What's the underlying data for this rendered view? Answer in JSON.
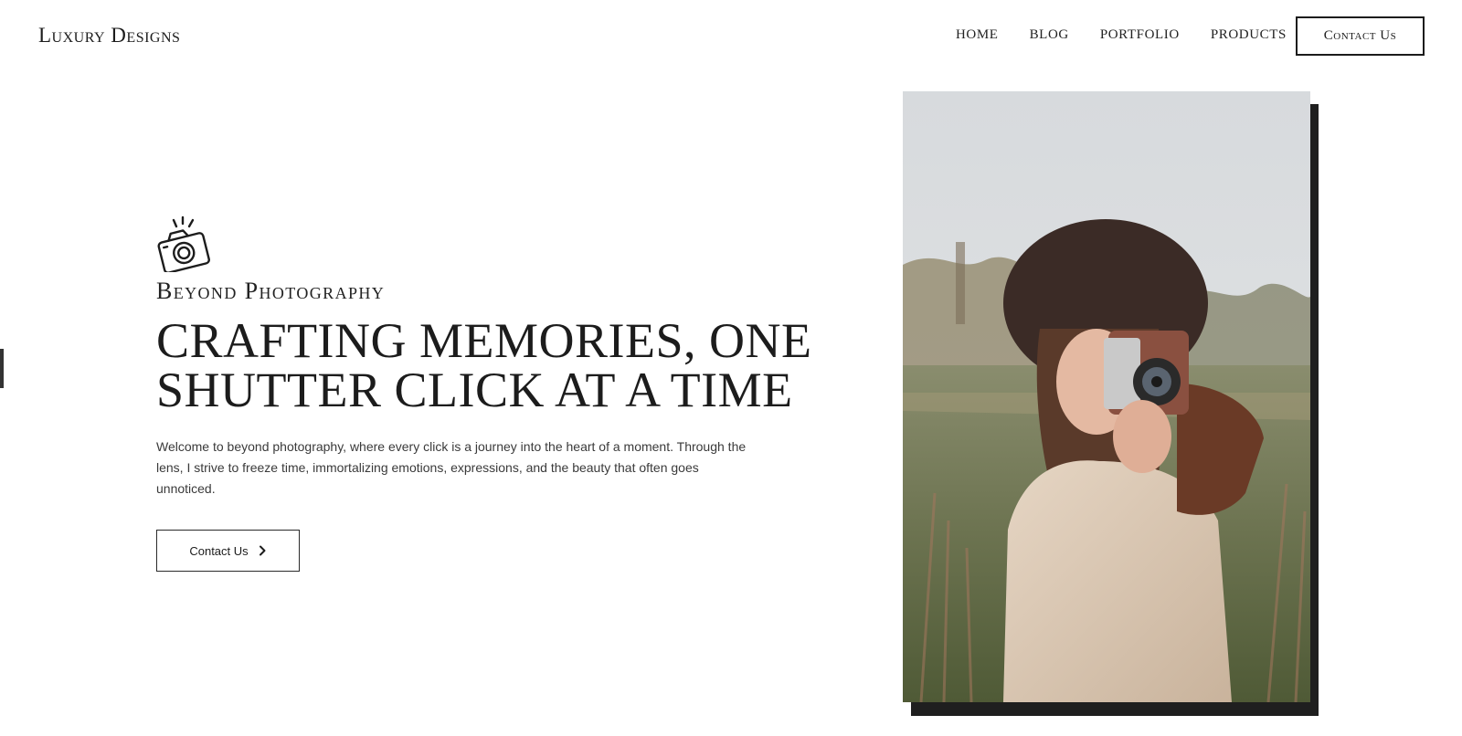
{
  "header": {
    "logo": "Luxury Designs",
    "nav": [
      "HOME",
      "BLOG",
      "PORTFOLIO",
      "PRODUCTS"
    ],
    "contact_label": "Contact Us"
  },
  "hero": {
    "icon": "camera-icon",
    "eyebrow": "Beyond Photography",
    "headline": "Crafting Memories, One Shutter Click at a Time",
    "intro": "Welcome to beyond photography, where every click is a journey into the heart of a moment. Through the lens, I strive to freeze time, immortalizing emotions, expressions, and the beauty that often goes unnoticed.",
    "cta_label": "Contact Us",
    "cta_icon": "chevron-right-icon"
  },
  "photo": {
    "alt": "woman-with-vintage-camera-photo"
  },
  "colors": {
    "text": "#1c1c1c",
    "shadow": "#1f1f1f",
    "background": "#ffffff"
  }
}
